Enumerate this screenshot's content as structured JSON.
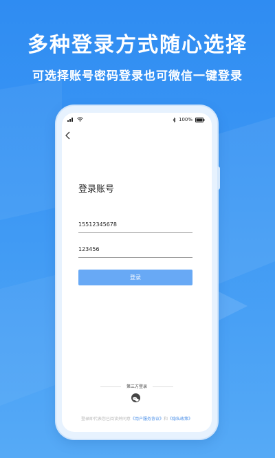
{
  "headline": "多种登录方式随心选择",
  "subheadline": "可选择账号密码登录也可微信一键登录",
  "status_bar": {
    "battery": "100%"
  },
  "login": {
    "title": "登录账号",
    "phone_value": "15512345678",
    "password_value": "123456",
    "button_label": "登录"
  },
  "third_party": {
    "label": "第三方登录",
    "icon": "wechat-icon"
  },
  "agreement": {
    "prefix": "登录即代表您已阅读并同意",
    "user_agreement": "《用户服务协议》",
    "and": "和",
    "privacy_policy": "《隐私政策》"
  },
  "colors": {
    "background": "#3d98f4",
    "button": "#68a9f5",
    "link": "#4a8fe8"
  }
}
